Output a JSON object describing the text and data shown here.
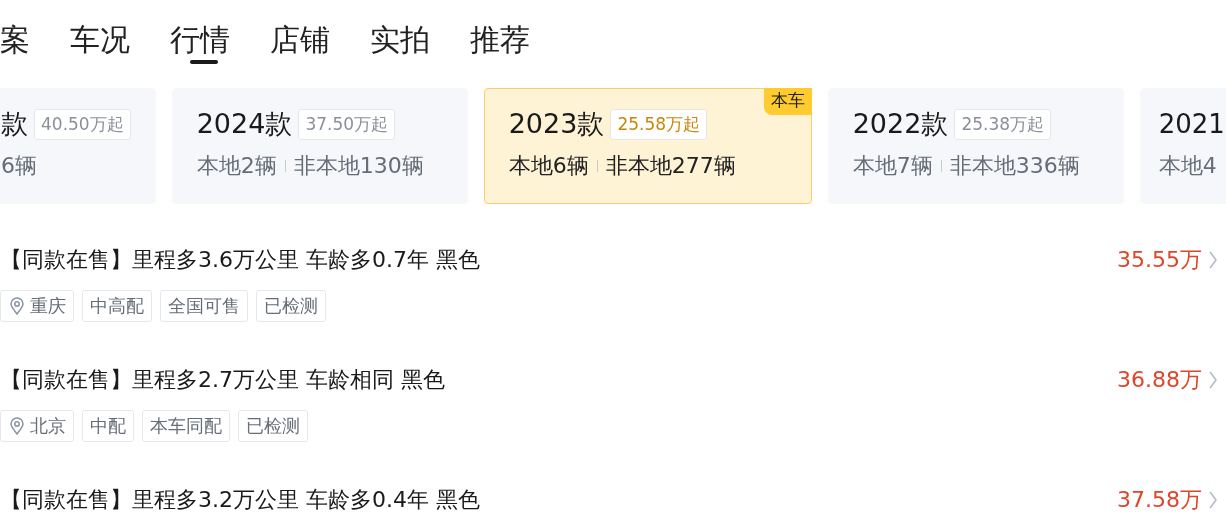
{
  "tabs": [
    {
      "label": "案",
      "selected": false
    },
    {
      "label": "车况",
      "selected": false
    },
    {
      "label": "行情",
      "selected": true
    },
    {
      "label": "店铺",
      "selected": false
    },
    {
      "label": "实拍",
      "selected": false
    },
    {
      "label": "推荐",
      "selected": false
    }
  ],
  "model_years": [
    {
      "title": "款",
      "price": "40.50万起",
      "counts": [
        "6辆"
      ],
      "selected": false
    },
    {
      "title": "2024款",
      "price": "37.50万起",
      "counts": [
        "本地2辆",
        "非本地130辆"
      ],
      "selected": false
    },
    {
      "title": "2023款",
      "price": "25.58万起",
      "counts": [
        "本地6辆",
        "非本地277辆"
      ],
      "selected": true,
      "badge": "本车"
    },
    {
      "title": "2022款",
      "price": "25.38万起",
      "counts": [
        "本地7辆",
        "非本地336辆"
      ],
      "selected": false
    },
    {
      "title": "2021",
      "counts": [
        "本地4"
      ],
      "selected": false
    }
  ],
  "listings": [
    {
      "title": "【同款在售】里程多3.6万公里 车龄多0.7年 黑色",
      "price": "35.55万",
      "location": "重庆",
      "tags": [
        "中高配",
        "全国可售",
        "已检测"
      ]
    },
    {
      "title": "【同款在售】里程多2.7万公里 车龄相同 黑色",
      "price": "36.88万",
      "location": "北京",
      "tags": [
        "中配",
        "本车同配",
        "已检测"
      ]
    },
    {
      "title": "【同款在售】里程多3.2万公里 车龄多0.4年 黑色",
      "price": "37.58万"
    }
  ]
}
